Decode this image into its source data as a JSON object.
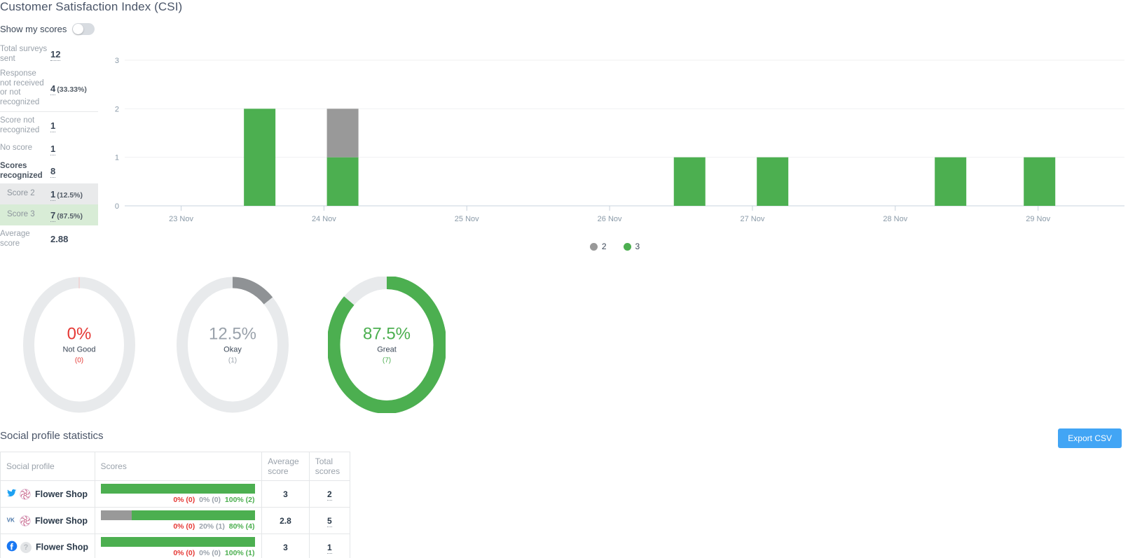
{
  "header": {
    "title": "Customer Satisfaction Index (CSI)",
    "toggle_label": "Show my scores",
    "toggle_on": false
  },
  "stats": [
    {
      "label": "Total surveys sent",
      "value": "12",
      "pct": ""
    },
    {
      "label": "Response not received or not recognized",
      "value": "4",
      "pct": "(33.33%)"
    },
    {
      "label": "Score not recognized",
      "value": "1",
      "pct": ""
    },
    {
      "label": "No score",
      "value": "1",
      "pct": ""
    },
    {
      "label": "Scores recognized",
      "value": "8",
      "pct": ""
    },
    {
      "label": "Score 2",
      "value": "1",
      "pct": "(12.5%)"
    },
    {
      "label": "Score 3",
      "value": "7",
      "pct": "(87.5%)"
    },
    {
      "label": "Average score",
      "value": "2.88",
      "pct": ""
    }
  ],
  "chart_data": {
    "type": "bar",
    "stacked": true,
    "title": "",
    "xlabel": "",
    "ylabel": "",
    "ylim": [
      0,
      3
    ],
    "yticks": [
      0,
      1,
      2,
      3
    ],
    "ytick_labels": [
      "0",
      "1",
      "2",
      "3"
    ],
    "grid": true,
    "legend_position": "bottom",
    "tick_labels": [
      "23 Nov",
      "24 Nov",
      "25 Nov",
      "26 Nov",
      "27 Nov",
      "28 Nov",
      "29 Nov"
    ],
    "series": [
      {
        "name": "2",
        "color": "#999999"
      },
      {
        "name": "3",
        "color": "#4caf50"
      }
    ],
    "bars": [
      {
        "x_frac": 0.135,
        "score2": 0,
        "score3": 2
      },
      {
        "x_frac": 0.218,
        "score2": 1,
        "score3": 1
      },
      {
        "x_frac": 0.565,
        "score2": 0,
        "score3": 1
      },
      {
        "x_frac": 0.648,
        "score2": 0,
        "score3": 1
      },
      {
        "x_frac": 0.826,
        "score2": 0,
        "score3": 1
      },
      {
        "x_frac": 0.915,
        "score2": 0,
        "score3": 1
      }
    ]
  },
  "donuts": [
    {
      "pct_label": "0%",
      "label": "Not Good",
      "count_label": "(0)",
      "value": 0,
      "color": "#e53935"
    },
    {
      "pct_label": "12.5%",
      "label": "Okay",
      "count_label": "(1)",
      "value": 12.5,
      "color": "#8f9295"
    },
    {
      "pct_label": "87.5%",
      "label": "Great",
      "count_label": "(7)",
      "value": 87.5,
      "color": "#4caf50"
    }
  ],
  "social": {
    "title": "Social profile statistics",
    "export_label": "Export CSV",
    "columns": [
      "Social profile",
      "Scores",
      "Average score",
      "Total scores"
    ],
    "rows": [
      {
        "network": "twitter",
        "avatar": "flower",
        "name": "Flower Shop",
        "bar": {
          "bad": 0,
          "okay": 0,
          "great": 100
        },
        "legend": {
          "bad": "0% (0)",
          "okay": "0% (0)",
          "great": "100% (2)"
        },
        "average": "3",
        "total": "2"
      },
      {
        "network": "vk",
        "avatar": "flower",
        "name": "Flower Shop",
        "bar": {
          "bad": 0,
          "okay": 20,
          "great": 80
        },
        "legend": {
          "bad": "0% (0)",
          "okay": "20% (1)",
          "great": "80% (4)"
        },
        "average": "2.8",
        "total": "5"
      },
      {
        "network": "facebook",
        "avatar": "question",
        "name": "Flower Shop",
        "bar": {
          "bad": 0,
          "okay": 0,
          "great": 100
        },
        "legend": {
          "bad": "0% (0)",
          "okay": "0% (0)",
          "great": "100% (1)"
        },
        "average": "3",
        "total": "1"
      }
    ]
  },
  "colors": {
    "green": "#4caf50",
    "gray": "#999999",
    "red": "#e53935",
    "track": "#e8eaec",
    "accent_blue": "#42a5f5"
  }
}
